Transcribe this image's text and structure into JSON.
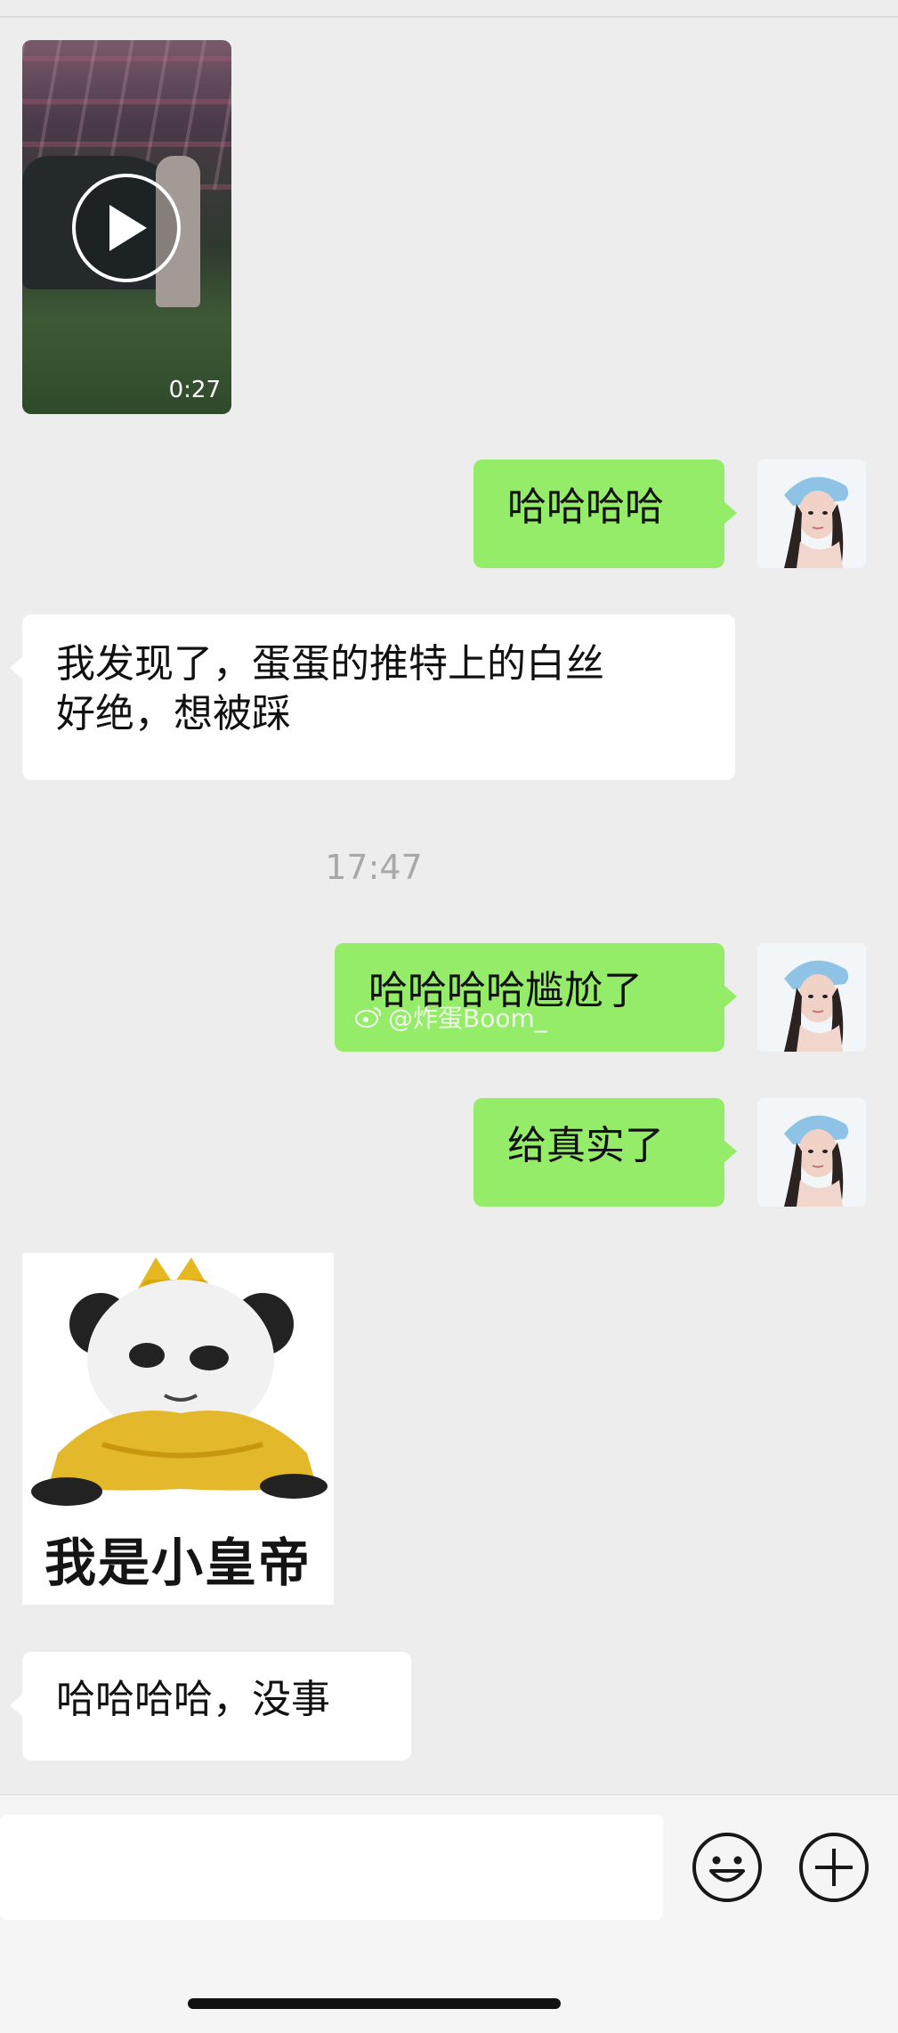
{
  "chat": {
    "video": {
      "duration": "0:27"
    },
    "messages": [
      {
        "sender": "me",
        "text": "哈哈哈哈"
      },
      {
        "sender": "them",
        "text_line1": "我发现了，蛋蛋的推特上的白丝",
        "text_line2": "好绝，想被踩"
      },
      {
        "timestamp": "17:47"
      },
      {
        "sender": "me",
        "text": "哈哈哈哈尴尬了"
      },
      {
        "sender": "me",
        "text": "给真实了"
      },
      {
        "sender": "them",
        "sticker_caption": "我是小皇帝"
      },
      {
        "sender": "them",
        "text": "哈哈哈哈，没事"
      }
    ],
    "watermark": "@炸蛋Boom_"
  },
  "input_bar": {
    "value": "",
    "emoji_icon": "smiley-icon",
    "plus_icon": "plus-circle-icon"
  },
  "colors": {
    "me_bubble": "#95ec69",
    "them_bubble": "#ffffff",
    "background": "#ededed"
  }
}
